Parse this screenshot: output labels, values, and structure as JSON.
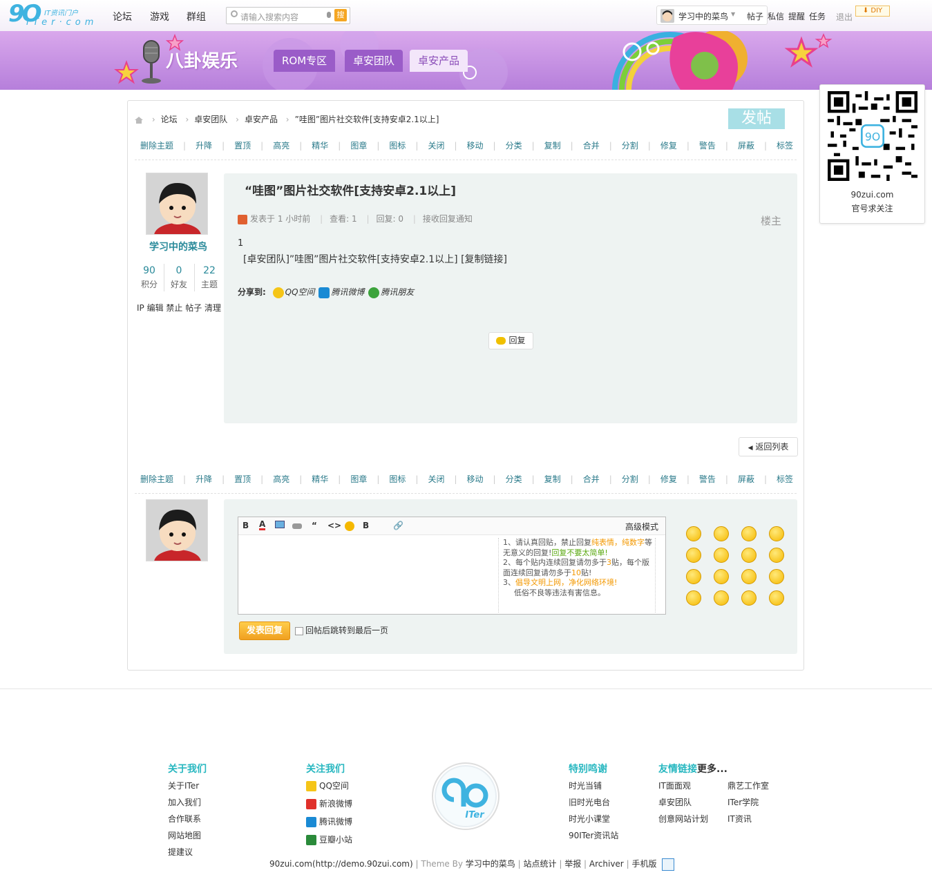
{
  "topbar": {
    "logo_big": "9O",
    "logo_sub1": "IT资讯门户",
    "logo_sub2": "ITer·com",
    "nav": [
      "论坛",
      "游戏",
      "群组"
    ],
    "search": {
      "placeholder": "请输入搜索内容",
      "button": "搜"
    },
    "user": {
      "name": "学习中的菜鸟"
    },
    "links": [
      "帖子",
      "私信",
      "提醒",
      "任务"
    ],
    "logout": "退出",
    "diy": "DIY"
  },
  "banner": {
    "title": "八卦娱乐",
    "tabs": [
      {
        "label": "ROM专区",
        "active": false
      },
      {
        "label": "卓安团队",
        "active": false
      },
      {
        "label": "卓安产品",
        "active": true
      }
    ]
  },
  "qr": {
    "line1": "90zui.com",
    "line2": "官号求关注"
  },
  "breadcrumb": [
    "论坛",
    "卓安团队",
    "卓安产品",
    "”哇图”图片社交软件[支持安卓2.1以上]"
  ],
  "post_button": "发帖",
  "mod_actions": [
    "删除主题",
    "升降",
    "置顶",
    "高亮",
    "精华",
    "图章",
    "图标",
    "关闭",
    "移动",
    "分类",
    "复制",
    "合并",
    "分割",
    "修复",
    "警告",
    "屏蔽",
    "标签"
  ],
  "author": {
    "name": "学习中的菜鸟",
    "stats": [
      {
        "value": "90",
        "label": "积分"
      },
      {
        "value": "0",
        "label": "好友"
      },
      {
        "value": "22",
        "label": "主题"
      }
    ],
    "admin_links": "IP 编辑 禁止 帖子 清理"
  },
  "post": {
    "title": "“哇图”图片社交软件[支持安卓2.1以上]",
    "meta": {
      "posted": "发表于 1 小时前",
      "views": "查看: 1",
      "replies": "回复: 0",
      "notify": "接收回复通知"
    },
    "floor": "楼主",
    "body_line1": "1",
    "body_line2": "[卓安团队]”哇图”图片社交软件[支持安卓2.1以上] [复制链接]",
    "share_label": "分享到:",
    "share_items": [
      "QQ空间",
      "腾讯微博",
      "腾讯朋友"
    ],
    "reply_button": "回复"
  },
  "back_button": "返回列表",
  "editor": {
    "advanced": "高级模式",
    "tips": {
      "t1a": "1、请认真回贴，禁止回复",
      "t1b": "纯表情，纯数字",
      "t1c": "等无意义的回复!",
      "t1d": "回复不要太简单!",
      "t2a": "2、每个贴内连续回复请勿多于",
      "t2b": "3",
      "t2c": "贴，每个版面连续回复请勿多于",
      "t2d": "10",
      "t2e": "贴!",
      "t3a": "3、",
      "t3b": "倡导文明上网，净化网络环境!",
      "t3c": "低俗不良等违法有害信息。"
    },
    "submit": "发表回复",
    "jump_label": "回帖后跳转到最后一页"
  },
  "footer": {
    "about": {
      "head": "关于我们",
      "items": [
        "关于ITer",
        "加入我们",
        "合作联系",
        "网站地图",
        "提建议"
      ]
    },
    "follow": {
      "head": "关注我们",
      "items": [
        "QQ空间",
        "新浪微博",
        "腾讯微博",
        "豆瓣小站"
      ]
    },
    "thanks": {
      "head": "特别鸣谢",
      "items": [
        "时光当铺",
        "旧时光电台",
        "时光小课堂",
        "90ITer资讯站"
      ]
    },
    "friends": {
      "head": "友情链接",
      "more": "更多...",
      "col1": [
        "IT面面观",
        "卓安团队",
        "创意网站计划"
      ],
      "col2": [
        "鼎艺工作室",
        "ITer学院",
        "IT资讯"
      ]
    },
    "logo_text": "ITer",
    "copyright": {
      "site": "90zui.com",
      "url": "(http://demo.90zui.com)",
      "theme": "Theme By",
      "author": "学习中的菜鸟",
      "links": [
        "站点统计",
        "举报",
        "Archiver",
        "手机版"
      ]
    }
  },
  "colors": {
    "accent": "#2a8a9a",
    "banner": "#c494e4",
    "orange": "#f39800"
  }
}
